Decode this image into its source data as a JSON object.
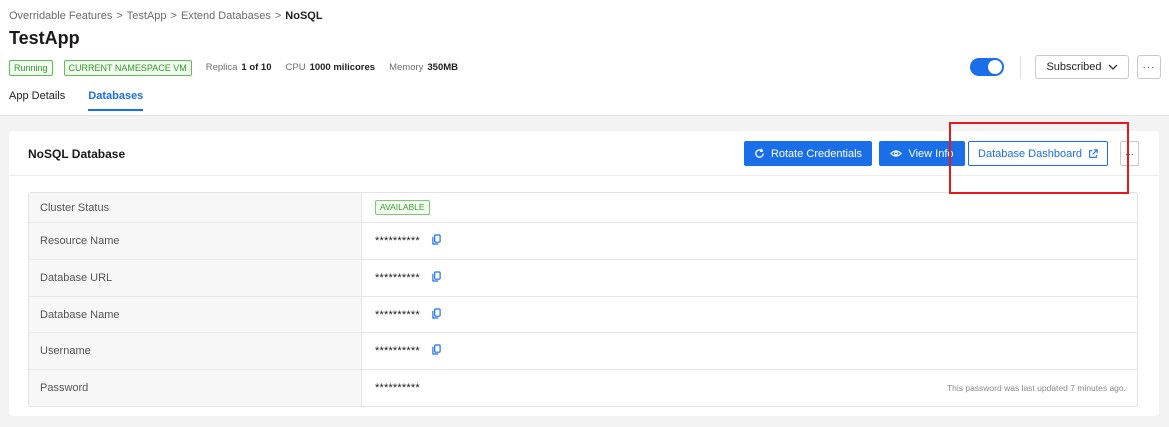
{
  "breadcrumb": {
    "items": [
      "Overridable Features",
      "TestApp",
      "Extend Databases"
    ],
    "separator": ">",
    "current": "NoSQL"
  },
  "app": {
    "title": "TestApp",
    "status_badge": "Running",
    "namespace_badge": "CURRENT NAMESPACE VM",
    "replica_label": "Replica",
    "replica_value": "1 of 10",
    "cpu_label": "CPU",
    "cpu_value": "1000 milicores",
    "memory_label": "Memory",
    "memory_value": "350MB",
    "toggle_on": true,
    "subscribed_label": "Subscribed",
    "more_label": "···"
  },
  "tabs": [
    {
      "label": "App Details",
      "active": false
    },
    {
      "label": "Databases",
      "active": true
    }
  ],
  "card": {
    "title": "NoSQL Database",
    "rotate_label": "Rotate Credentials",
    "view_info_label": "View Info",
    "dashboard_label": "Database Dashboard",
    "more_label": "···",
    "rows": [
      {
        "label": "Cluster Status",
        "type": "badge",
        "value": "AVAILABLE"
      },
      {
        "label": "Resource Name",
        "type": "masked",
        "value": "**********",
        "copy": true
      },
      {
        "label": "Database URL",
        "type": "masked",
        "value": "**********",
        "copy": true
      },
      {
        "label": "Database Name",
        "type": "masked",
        "value": "**********",
        "copy": true
      },
      {
        "label": "Username",
        "type": "masked",
        "value": "**********",
        "copy": true
      },
      {
        "label": "Password",
        "type": "masked",
        "value": "**********",
        "copy": false,
        "note": "This password was last updated 7 minutes ago."
      }
    ]
  },
  "colors": {
    "accent": "#1a6fe8",
    "success": "#2e9b23",
    "highlight": "#e5191c"
  }
}
